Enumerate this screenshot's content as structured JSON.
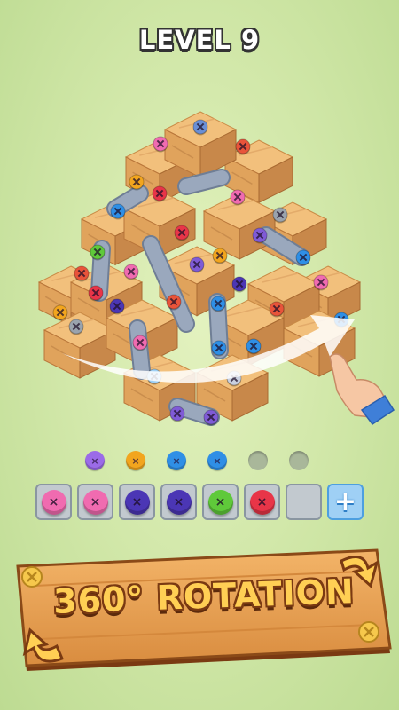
{
  "header": {
    "level_label": "LEVEL 9"
  },
  "targets": [
    {
      "color": "#9b6be8",
      "icon": "screw-icon"
    },
    {
      "color": "#f2a51e",
      "icon": "screw-icon"
    },
    {
      "color": "#2f8fe6",
      "icon": "screw-icon"
    },
    {
      "color": "#2f8fe6",
      "icon": "screw-icon"
    },
    {
      "color": "",
      "icon": "empty-hole-icon"
    },
    {
      "color": "",
      "icon": "empty-hole-icon"
    }
  ],
  "slots": [
    {
      "color": "#f06bb0",
      "icon": "screw-icon"
    },
    {
      "color": "#f06bb0",
      "icon": "screw-icon"
    },
    {
      "color": "#4b36b5",
      "icon": "screw-icon"
    },
    {
      "color": "#4b36b5",
      "icon": "screw-icon"
    },
    {
      "color": "#5fc93a",
      "icon": "screw-icon"
    },
    {
      "color": "#e83548",
      "icon": "screw-icon"
    },
    {
      "color": "",
      "icon": "empty-slot"
    },
    {
      "color": "",
      "icon": "plus-icon"
    }
  ],
  "banner": {
    "text": "360° ROTATION"
  },
  "colors": {
    "wood_top": "#f2c07c",
    "wood_left": "#e0a35c",
    "wood_right": "#c8884a",
    "plank": "#9aa8bd",
    "slot_bg": "#c2c9cf",
    "plus_slot": "#9fd0f5",
    "banner_wood": "#e9a356",
    "banner_text": "#ffcf54"
  },
  "hint": {
    "icon": "pointing-hand-icon",
    "arrow": "rotation-arrow-icon"
  }
}
